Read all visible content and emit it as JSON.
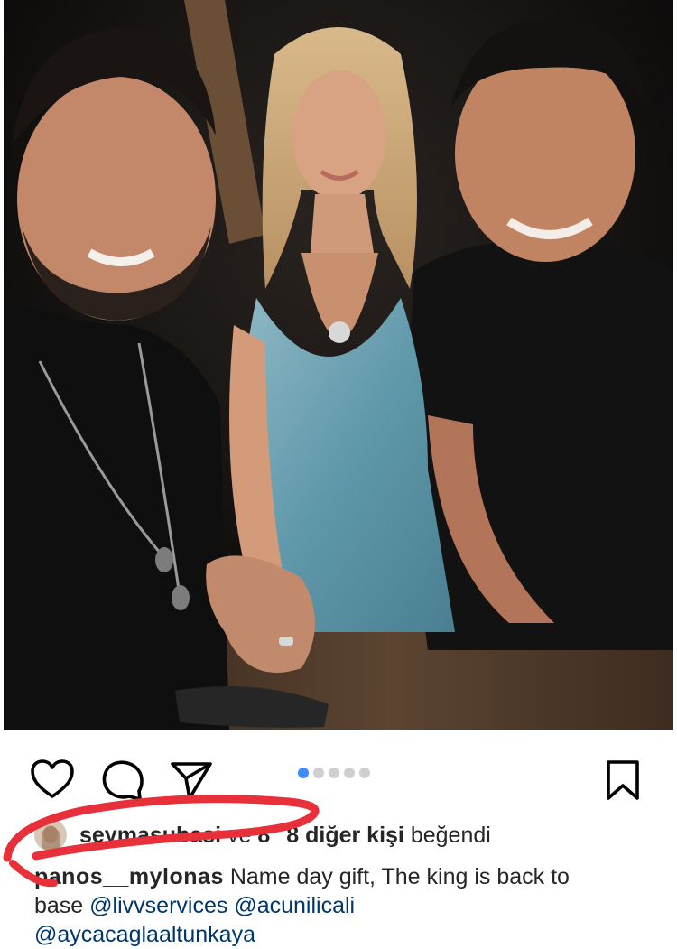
{
  "post": {
    "photo": {
      "alt": "Three people posing together at night at a wooden table"
    },
    "actions": {
      "like_icon": "heart-icon",
      "comment_icon": "comment-icon",
      "share_icon": "send-icon",
      "save_icon": "bookmark-icon"
    },
    "carousel": {
      "total": 5,
      "active_index": 0
    },
    "likes": {
      "username": "seymasubasi",
      "connector": "ve",
      "count_text": "8",
      "count_text_end": "8 diğer kişi",
      "suffix": "beğendi"
    },
    "caption": {
      "author": "panos__mylonas",
      "text_line1": "Name day gift, The king is back to",
      "text_line2_prefix": "base",
      "mention1": "@livvservices",
      "mention2": "@acunilicali",
      "mention3": "@aycacaglaaltunkaya"
    }
  },
  "colors": {
    "accent": "#3d8bfd",
    "annotation": "#e8303a",
    "text": "#262626",
    "mention": "#00376b"
  }
}
